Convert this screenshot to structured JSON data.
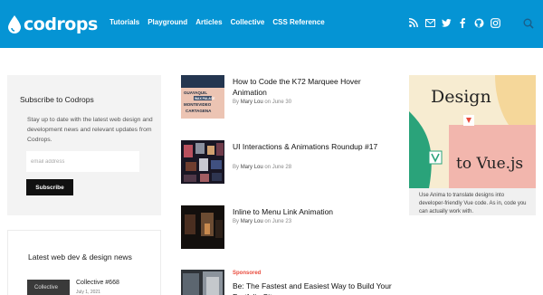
{
  "header": {
    "logo": "codrops",
    "nav": [
      "Tutorials",
      "Playground",
      "Articles",
      "Collective",
      "CSS Reference"
    ],
    "social_icons": [
      "rss-icon",
      "mail-icon",
      "twitter-icon",
      "facebook-icon",
      "github-icon",
      "instagram-icon"
    ],
    "colors": {
      "bar": "#0594d4",
      "text": "#ffffff"
    }
  },
  "subscribe": {
    "title": "Subscribe to Codrops",
    "text": "Stay up to date with the latest web design and development news and relevant updates from Codrops.",
    "email_placeholder": "email address",
    "button": "Subscribe"
  },
  "news": {
    "title": "Latest web dev & design news",
    "item_title": "Collective #668",
    "item_date": "July 1, 2021",
    "item_thumb_label": "Collective"
  },
  "articles": [
    {
      "title": "How to Code the K72 Marquee Hover Animation",
      "by": "By",
      "author": "Mary Lou",
      "on": "on June 30"
    },
    {
      "title": "UI Interactions & Animations Roundup #17",
      "by": "By",
      "author": "Mary Lou",
      "on": "on June 28"
    },
    {
      "title": "Inline to Menu Link Animation",
      "by": "By",
      "author": "Mary Lou",
      "on": "on June 23"
    },
    {
      "title": "Be: The Fastest and Easiest Way to Build Your Portfolio Site",
      "sponsored": "Sponsored"
    }
  ],
  "thumb1_text": [
    "GUAYAQUIL",
    "WAX PALACE",
    "MONTEVIDEO",
    "CARTAGENA"
  ],
  "ad": {
    "line1": "Design",
    "line2": "to Vue.js",
    "caption": "Use Anima to translate designs into developer-friendly Vue code. As in, code you can actually work with.",
    "colors": {
      "cream": "#f7ecd1",
      "green": "#2aa37a",
      "pink": "#f2b6ad",
      "red": "#e94b3c"
    }
  }
}
